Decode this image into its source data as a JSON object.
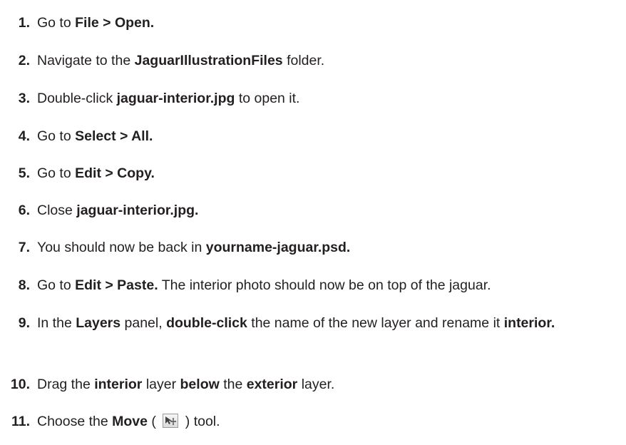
{
  "steps": [
    {
      "number": "1.",
      "parts": [
        "Go to ",
        "File > Open."
      ]
    },
    {
      "number": "2.",
      "parts": [
        "Navigate to the ",
        "JaguarIllustrationFiles",
        " folder."
      ]
    },
    {
      "number": "3.",
      "parts": [
        "Double-click ",
        "jaguar-interior.jpg",
        " to open it."
      ]
    },
    {
      "number": "4.",
      "parts": [
        "Go to ",
        "Select > All."
      ]
    },
    {
      "number": "5.",
      "parts": [
        "Go to ",
        "Edit > Copy."
      ]
    },
    {
      "number": "6.",
      "parts": [
        "Close ",
        "jaguar-interior.jpg."
      ]
    },
    {
      "number": "7.",
      "parts": [
        "You should now be back in ",
        "yourname-jaguar.psd."
      ]
    },
    {
      "number": "8.",
      "parts": [
        "Go to ",
        "Edit > Paste.",
        " The interior photo should now be on top of the jaguar."
      ]
    },
    {
      "number": "9.",
      "parts": [
        "In the ",
        "Layers",
        " panel, ",
        "double-click",
        " the name of the new layer and rename it ",
        "interior."
      ]
    },
    {
      "number": "10.",
      "parts": [
        "Drag the ",
        "interior",
        " layer ",
        "below",
        " the ",
        "exterior",
        " layer."
      ]
    },
    {
      "number": "11.",
      "parts": [
        "Choose the ",
        "Move",
        " ( ",
        " ) tool."
      ]
    }
  ],
  "icons": {
    "move_tool": "move-tool-icon"
  }
}
